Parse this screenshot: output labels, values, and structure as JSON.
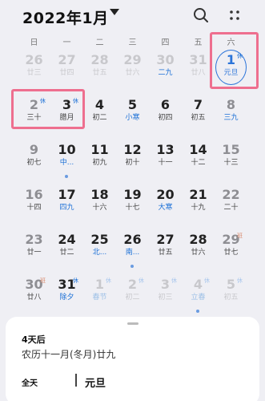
{
  "header": {
    "title": "2022年1月",
    "dropdown_icon": "chevron-down-icon",
    "search_icon": "search-icon",
    "more_icon": "more-icon"
  },
  "weekdays": [
    "日",
    "一",
    "二",
    "三",
    "四",
    "五",
    "六"
  ],
  "colors": {
    "accent": "#2b74d9",
    "work_tag": "#d98a6c",
    "highlight_box": "#ee6f8f"
  },
  "weeks": [
    [
      {
        "num": "26",
        "lunar": "廿三",
        "faded": true
      },
      {
        "num": "27",
        "lunar": "廿四",
        "faded": true
      },
      {
        "num": "28",
        "lunar": "廿五",
        "faded": true
      },
      {
        "num": "29",
        "lunar": "廿六",
        "faded": true
      },
      {
        "num": "30",
        "lunar": "二九",
        "faded": true,
        "lunar_hl": true
      },
      {
        "num": "31",
        "lunar": "廿八",
        "faded": true
      },
      {
        "num": "1",
        "lunar": "元旦",
        "today": true,
        "tag": "休"
      }
    ],
    [
      {
        "num": "2",
        "lunar": "三十",
        "tag": "休",
        "weekend": true
      },
      {
        "num": "3",
        "lunar": "腊月",
        "tag": "休"
      },
      {
        "num": "4",
        "lunar": "初二"
      },
      {
        "num": "5",
        "lunar": "小寒",
        "lunar_hl": true
      },
      {
        "num": "6",
        "lunar": "初四"
      },
      {
        "num": "7",
        "lunar": "初五"
      },
      {
        "num": "8",
        "lunar": "三九",
        "weekend": true,
        "lunar_hl": true
      }
    ],
    [
      {
        "num": "9",
        "lunar": "初七",
        "weekend": true
      },
      {
        "num": "10",
        "lunar": "中...",
        "lunar_hl": true,
        "dot": true
      },
      {
        "num": "11",
        "lunar": "初九"
      },
      {
        "num": "12",
        "lunar": "初十"
      },
      {
        "num": "13",
        "lunar": "十一"
      },
      {
        "num": "14",
        "lunar": "十二"
      },
      {
        "num": "15",
        "lunar": "十三",
        "weekend": true
      }
    ],
    [
      {
        "num": "16",
        "lunar": "十四",
        "weekend": true
      },
      {
        "num": "17",
        "lunar": "四九",
        "lunar_hl": true
      },
      {
        "num": "18",
        "lunar": "十六"
      },
      {
        "num": "19",
        "lunar": "十七"
      },
      {
        "num": "20",
        "lunar": "大寒",
        "lunar_hl": true
      },
      {
        "num": "21",
        "lunar": "十九"
      },
      {
        "num": "22",
        "lunar": "二十",
        "weekend": true
      }
    ],
    [
      {
        "num": "23",
        "lunar": "廿一",
        "weekend": true
      },
      {
        "num": "24",
        "lunar": "廿二"
      },
      {
        "num": "25",
        "lunar": "北...",
        "lunar_hl": true
      },
      {
        "num": "26",
        "lunar": "南...",
        "lunar_hl": true,
        "dot": true
      },
      {
        "num": "27",
        "lunar": "廿五"
      },
      {
        "num": "28",
        "lunar": "廿六"
      },
      {
        "num": "29",
        "lunar": "廿七",
        "tag": "班",
        "tag_work": true,
        "weekend": true
      }
    ],
    [
      {
        "num": "30",
        "lunar": "廿八",
        "tag": "班",
        "tag_work": true,
        "weekend": true
      },
      {
        "num": "31",
        "lunar": "除夕",
        "tag": "休",
        "lunar_hl": true
      },
      {
        "num": "1",
        "lunar": "春节",
        "tag": "休",
        "faded": true,
        "lunar_hl_faded": true
      },
      {
        "num": "2",
        "lunar": "初二",
        "tag": "休",
        "faded": true
      },
      {
        "num": "3",
        "lunar": "初三",
        "tag": "休",
        "faded": true
      },
      {
        "num": "4",
        "lunar": "立春",
        "tag": "休",
        "faded": true,
        "lunar_hl_faded": true,
        "dot": true
      },
      {
        "num": "5",
        "lunar": "初五",
        "tag": "休",
        "faded": true
      }
    ]
  ],
  "sheet": {
    "days_after": "4天后",
    "lunar_date": "农历十一月(冬月)廿九",
    "allday_label": "全天",
    "event_title": "元旦"
  }
}
